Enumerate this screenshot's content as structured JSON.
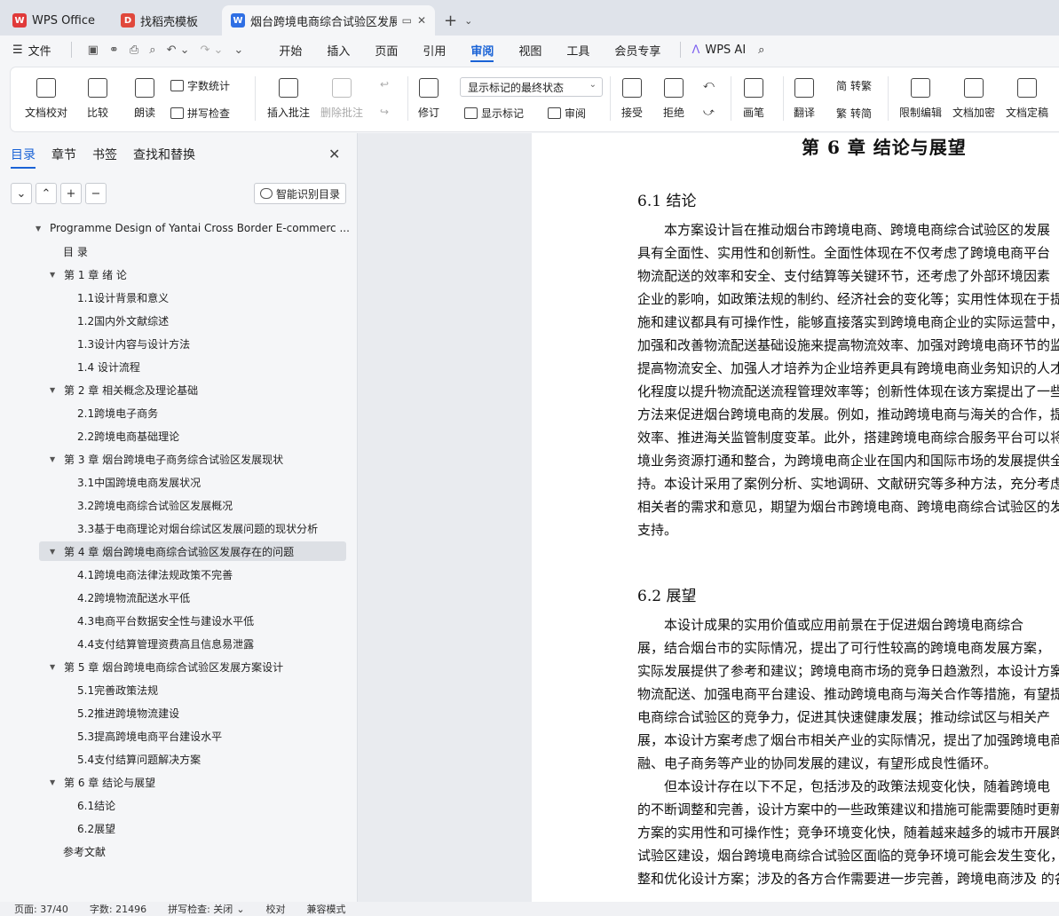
{
  "titlebar": {
    "tabs": [
      {
        "title": "WPS Office",
        "logo": "W"
      },
      {
        "title": "找稻壳模板",
        "logo": "D"
      },
      {
        "title": "烟台跨境电商综合试验区发展方"
      }
    ],
    "new_tab": "+"
  },
  "menu": {
    "file": "文件",
    "items": [
      "开始",
      "插入",
      "页面",
      "引用",
      "审阅",
      "视图",
      "工具",
      "会员专享"
    ],
    "active": "审阅",
    "wps_ai": "WPS AI"
  },
  "ribbon": {
    "doc_check": "文档校对",
    "compare": "比较",
    "read_aloud": "朗读",
    "word_count": "字数统计",
    "spell_check": "拼写检查",
    "insert_comment": "插入批注",
    "delete_comment": "删除批注",
    "revise": "修订",
    "markup_state": "显示标记的最终状态",
    "show_markup": "显示标记",
    "review_pane": "审阅",
    "accept": "接受",
    "reject": "拒绝",
    "pen": "画笔",
    "translate": "翻译",
    "to_traditional": "转繁",
    "to_simplified": "转简",
    "restrict_edit": "限制编辑",
    "encrypt": "文档加密",
    "finalize": "文档定稿"
  },
  "sidebar": {
    "tabs": [
      "目录",
      "章节",
      "书签",
      "查找和替换"
    ],
    "smart_toc": "智能识别目录",
    "toc": [
      {
        "label": "Programme Design of Yantai Cross Border E-commerc ...",
        "level": 0,
        "arrow": true
      },
      {
        "label": "目 录",
        "level": 1,
        "arrow": false
      },
      {
        "label": "第 1 章 绪 论",
        "level": 1,
        "arrow": true
      },
      {
        "label": "1.1设计背景和意义",
        "level": 2,
        "arrow": false
      },
      {
        "label": "1.2国内外文献综述",
        "level": 2,
        "arrow": false
      },
      {
        "label": "1.3设计内容与设计方法",
        "level": 2,
        "arrow": false
      },
      {
        "label": "1.4 设计流程",
        "level": 2,
        "arrow": false
      },
      {
        "label": "第 2 章 相关概念及理论基础",
        "level": 1,
        "arrow": true
      },
      {
        "label": "2.1跨境电子商务",
        "level": 2,
        "arrow": false
      },
      {
        "label": "2.2跨境电商基础理论",
        "level": 2,
        "arrow": false
      },
      {
        "label": "第 3 章 烟台跨境电子商务综合试验区发展现状",
        "level": 1,
        "arrow": true
      },
      {
        "label": "3.1中国跨境电商发展状况",
        "level": 2,
        "arrow": false
      },
      {
        "label": "3.2跨境电商综合试验区发展概况",
        "level": 2,
        "arrow": false
      },
      {
        "label": "3.3基于电商理论对烟台综试区发展问题的现状分析",
        "level": 2,
        "arrow": false
      },
      {
        "label": "第 4 章 烟台跨境电商综合试验区发展存在的问题",
        "level": 1,
        "arrow": true,
        "selected": true
      },
      {
        "label": "4.1跨境电商法律法规政策不完善",
        "level": 2,
        "arrow": false
      },
      {
        "label": "4.2跨境物流配送水平低",
        "level": 2,
        "arrow": false
      },
      {
        "label": "4.3电商平台数据安全性与建设水平低",
        "level": 2,
        "arrow": false
      },
      {
        "label": "4.4支付结算管理资费高且信息易泄露",
        "level": 2,
        "arrow": false
      },
      {
        "label": "第 5 章 烟台跨境电商综合试验区发展方案设计",
        "level": 1,
        "arrow": true
      },
      {
        "label": "5.1完善政策法规",
        "level": 2,
        "arrow": false
      },
      {
        "label": "5.2推进跨境物流建设",
        "level": 2,
        "arrow": false
      },
      {
        "label": "5.3提高跨境电商平台建设水平",
        "level": 2,
        "arrow": false
      },
      {
        "label": "5.4支付结算问题解决方案",
        "level": 2,
        "arrow": false
      },
      {
        "label": "第 6 章 结论与展望",
        "level": 1,
        "arrow": true
      },
      {
        "label": "6.1结论",
        "level": 2,
        "arrow": false
      },
      {
        "label": "6.2展望",
        "level": 2,
        "arrow": false
      },
      {
        "label": "参考文献",
        "level": 1,
        "arrow": false
      }
    ]
  },
  "document": {
    "chapter_title": "第 6 章 结论与展望",
    "sec1_title": "6.1 结论",
    "sec1_lines": [
      "　　本方案设计旨在推动烟台市跨境电商、跨境电商综合试验区的发展",
      "具有全面性、实用性和创新性。全面性体现在不仅考虑了跨境电商平台",
      "物流配送的效率和安全、支付结算等关键环节，还考虑了外部环境因素",
      "企业的影响，如政策法规的制约、经济社会的变化等；实用性体现在于提",
      "施和建议都具有可操作性，能够直接落实到跨境电商企业的实际运营中，",
      "加强和改善物流配送基础设施来提高物流效率、加强对跨境电商环节的监",
      "提高物流安全、加强人才培养为企业培养更具有跨境电商业务知识的人才",
      "化程度以提升物流配送流程管理效率等；创新性体现在该方案提出了一些",
      "方法来促进烟台跨境电商的发展。例如，推动跨境电商与海关的合作，提",
      "效率、推进海关监管制度变革。此外，搭建跨境电商综合服务平台可以将",
      "境业务资源打通和整合，为跨境电商企业在国内和国际市场的发展提供全",
      "持。本设计采用了案例分析、实地调研、文献研究等多种方法，充分考虑",
      "相关者的需求和意见，期望为烟台市跨境电商、跨境电商综合试验区的发",
      "支持。"
    ],
    "sec2_title": "6.2 展望",
    "sec2_lines": [
      "　　本设计成果的实用价值或应用前景在于促进烟台跨境电商综合",
      "展，结合烟台市的实际情况，提出了可行性较高的跨境电商发展方案，",
      "实际发展提供了参考和建议；跨境电商市场的竞争日趋激烈，本设计方案",
      "物流配送、加强电商平台建设、推动跨境电商与海关合作等措施，有望提",
      "电商综合试验区的竞争力，促进其快速健康发展；推动综试区与相关产",
      "展，本设计方案考虑了烟台市相关产业的实际情况，提出了加强跨境电商",
      "融、电子商务等产业的协同发展的建议，有望形成良性循环。",
      "　　但本设计存在以下不足，包括涉及的政策法规变化快，随着跨境电",
      "的不断调整和完善，设计方案中的一些政策建议和措施可能需要随时更新",
      "方案的实用性和可操作性；竞争环境变化快，随着越来越多的城市开展跨",
      "试验区建设，烟台跨境电商综合试验区面临的竞争环境可能会发生变化，",
      "整和优化设计方案；涉及的各方合作需要进一步完善，跨境电商涉及 的各"
    ]
  },
  "status": {
    "page": "页面: 37/40",
    "words": "字数: 21496",
    "spell": "拼写检查: 关闭",
    "proof": "校对",
    "compat": "兼容模式"
  }
}
